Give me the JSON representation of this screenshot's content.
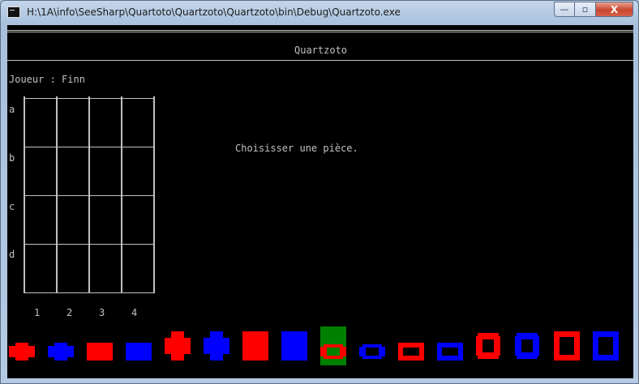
{
  "window": {
    "title": "H:\\1A\\info\\SeeSharp\\Quartoto\\Quartzoto\\Quartzoto\\bin\\Debug\\Quartzoto.exe",
    "buttons": {
      "minimize": "—",
      "maximize": "▫",
      "close": "X"
    }
  },
  "console": {
    "header": "Quartzoto",
    "player_line": "Joueur : Finn",
    "message": "Choisisser une pièce.",
    "board": {
      "row_labels": [
        "a",
        "b",
        "c",
        "d"
      ],
      "col_labels": [
        "1",
        "2",
        "3",
        "4"
      ]
    },
    "pieces": [
      {
        "color": "#ff0000",
        "shape": "cross",
        "size": "small",
        "filled": true,
        "selected": false
      },
      {
        "color": "#0000ff",
        "shape": "cross",
        "size": "small",
        "filled": true,
        "selected": false
      },
      {
        "color": "#ff0000",
        "shape": "square",
        "size": "small",
        "filled": true,
        "selected": false
      },
      {
        "color": "#0000ff",
        "shape": "square",
        "size": "small",
        "filled": true,
        "selected": false
      },
      {
        "color": "#ff0000",
        "shape": "cross",
        "size": "large",
        "filled": true,
        "selected": false
      },
      {
        "color": "#0000ff",
        "shape": "cross",
        "size": "large",
        "filled": true,
        "selected": false
      },
      {
        "color": "#ff0000",
        "shape": "square",
        "size": "large",
        "filled": true,
        "selected": false
      },
      {
        "color": "#0000ff",
        "shape": "square",
        "size": "large",
        "filled": true,
        "selected": false
      },
      {
        "color": "#ff0000",
        "shape": "ring",
        "size": "small",
        "filled": false,
        "selected": true
      },
      {
        "color": "#0000ff",
        "shape": "ring",
        "size": "small",
        "filled": false,
        "selected": false
      },
      {
        "color": "#ff0000",
        "shape": "square-outline",
        "size": "small",
        "filled": false,
        "selected": false
      },
      {
        "color": "#0000ff",
        "shape": "square-outline",
        "size": "small",
        "filled": false,
        "selected": false
      },
      {
        "color": "#ff0000",
        "shape": "ring",
        "size": "large",
        "filled": false,
        "selected": false
      },
      {
        "color": "#0000ff",
        "shape": "ring",
        "size": "large",
        "filled": false,
        "selected": false
      },
      {
        "color": "#ff0000",
        "shape": "square-outline",
        "size": "large",
        "filled": false,
        "selected": false
      },
      {
        "color": "#0000ff",
        "shape": "square-outline",
        "size": "large",
        "filled": false,
        "selected": false
      }
    ],
    "selected_cell_color": "#008000"
  }
}
